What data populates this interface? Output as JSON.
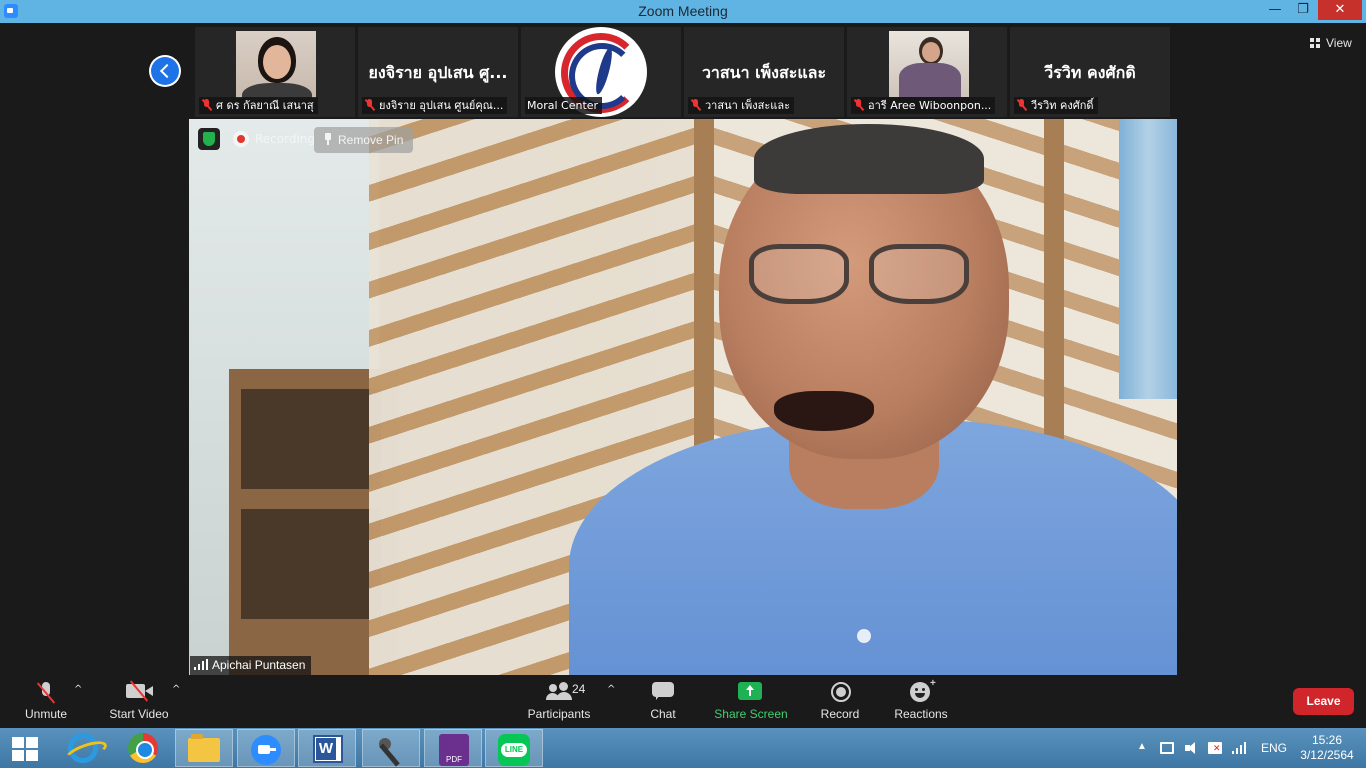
{
  "window": {
    "title": "Zoom Meeting",
    "controls": {
      "minimize": "—",
      "maximize": "❐",
      "close": "✕"
    }
  },
  "view_button": {
    "label": "View"
  },
  "thumbnails": [
    {
      "caption": "ศ ดร กัลยาณี เสนาสุ",
      "big_name": ""
    },
    {
      "caption": "ยงจิราย  อุปเสน ศูนย์คุณ...",
      "big_name": "ยงจิราย  อุปเสน ศู..."
    },
    {
      "caption": "Moral Center",
      "big_name": ""
    },
    {
      "caption": "วาสนา เพ็งสะและ",
      "big_name": "วาสนา เพ็งสะและ"
    },
    {
      "caption": "อารี Aree Wiboonpon...",
      "big_name": ""
    },
    {
      "caption": "วีรวิท  คงศักดิ์",
      "big_name": "วีรวิท  คงศักดิ"
    }
  ],
  "main_video": {
    "recording_label": "Recording",
    "remove_pin_label": "Remove Pin",
    "speaker_name": "Apichai Puntasen"
  },
  "controls": {
    "unmute": "Unmute",
    "start_video": "Start Video",
    "participants": "Participants",
    "participants_count": "24",
    "chat": "Chat",
    "share_screen": "Share Screen",
    "record": "Record",
    "reactions": "Reactions",
    "leave": "Leave",
    "caret": "^",
    "reactions_plus": "+"
  },
  "taskbar": {
    "language": "ENG",
    "time": "15:26",
    "date": "3/12/2564",
    "tray_expand": "▲"
  },
  "colors": {
    "title_bar": "#5fb4e4",
    "leave": "#d0262b",
    "share_screen": "#1fb254",
    "taskbar": "#4a85b2"
  }
}
